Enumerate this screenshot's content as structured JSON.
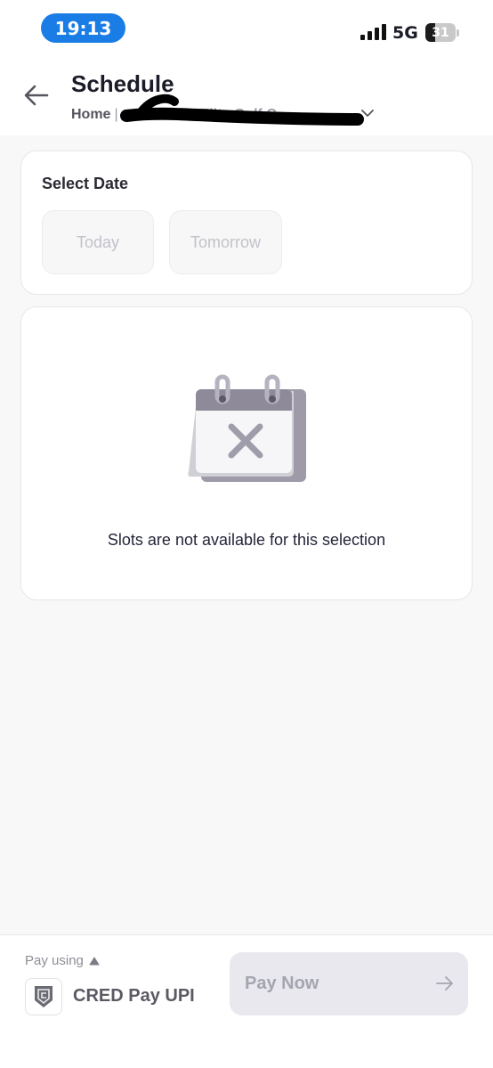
{
  "status_bar": {
    "time": "19:13",
    "network": "5G",
    "battery_level": 31,
    "battery_text": "31",
    "time_pill_color": "#1a7de6"
  },
  "header": {
    "back_icon": "arrow-left-icon",
    "title": "Schedule",
    "breadcrumb_home": "Home",
    "breadcrumb_separator": "|",
    "venue_fragment": "Elite Golf C",
    "dropdown_icon": "chevron-down-icon"
  },
  "date_section": {
    "title": "Select Date",
    "options": [
      "Today",
      "Tomorrow"
    ]
  },
  "empty_state": {
    "icon": "calendar-cross-icon",
    "message": "Slots are not available for this selection"
  },
  "payment": {
    "pay_using_label": "Pay using",
    "method_icon": "cred-logo-icon",
    "method_label": "CRED Pay UPI",
    "pay_button_label": "Pay Now",
    "pay_button_icon": "arrow-right-icon"
  }
}
